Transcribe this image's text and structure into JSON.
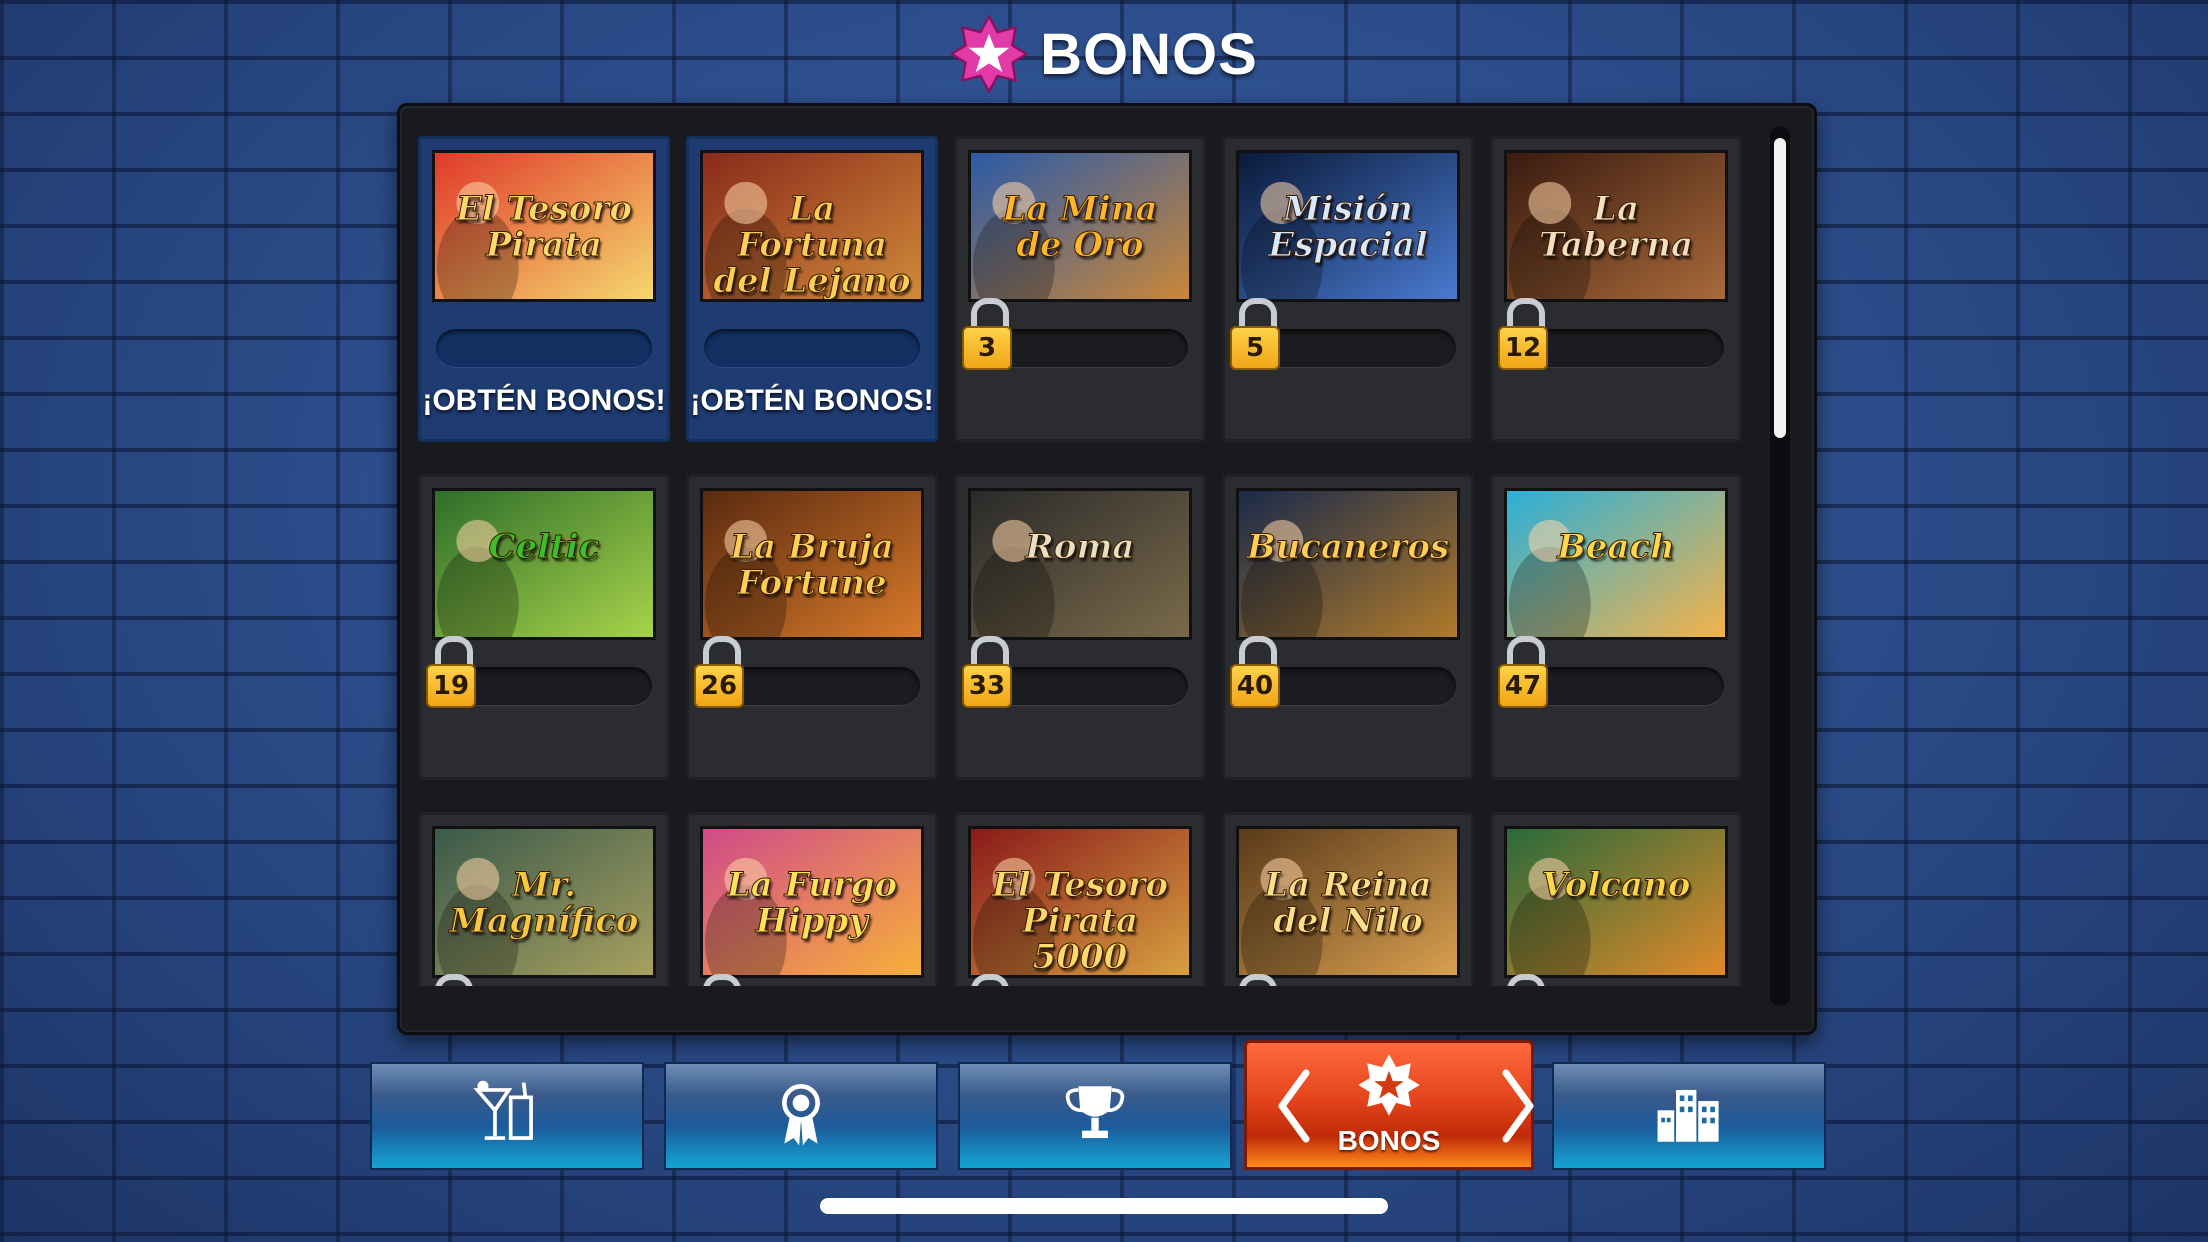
{
  "title": {
    "text": "BONOS",
    "icon": "star-badge-icon",
    "accent": "#e23aa6"
  },
  "cards": [
    {
      "name": "El Tesoro Pirata",
      "state": "unlocked",
      "action": "¡OBTÉN BONOS!",
      "colors": [
        "#e03a2a",
        "#f5d76e"
      ],
      "text_color": "#ffd86a"
    },
    {
      "name": "La Fortuna del Lejano Oeste",
      "state": "unlocked",
      "action": "¡OBTÉN BONOS!",
      "colors": [
        "#8a2a1a",
        "#d08a3a"
      ],
      "text_color": "#ffcf55"
    },
    {
      "name": "La Mina de Oro",
      "state": "locked",
      "level": "3",
      "colors": [
        "#2b5aa8",
        "#c9873a"
      ],
      "text_color": "#ffb62a"
    },
    {
      "name": "Misión Espacial",
      "state": "locked",
      "level": "5",
      "colors": [
        "#0a1a3a",
        "#4a7ad0"
      ],
      "text_color": "#d8e8ff"
    },
    {
      "name": "La Taberna",
      "state": "locked",
      "level": "12",
      "colors": [
        "#3a1a10",
        "#a86a3a"
      ],
      "text_color": "#f3e0c0"
    },
    {
      "name": "Celtic",
      "state": "locked",
      "level": "19",
      "colors": [
        "#2f6e2a",
        "#a7d34a"
      ],
      "text_color": "#3cbd2c"
    },
    {
      "name": "La Bruja Fortune",
      "state": "locked",
      "level": "26",
      "colors": [
        "#5a2a10",
        "#d87a2a"
      ],
      "text_color": "#ffcf55"
    },
    {
      "name": "Roma",
      "state": "locked",
      "level": "33",
      "colors": [
        "#2a2a2a",
        "#7a6a4a"
      ],
      "text_color": "#e8e0c0"
    },
    {
      "name": "Bucaneros",
      "state": "locked",
      "level": "40",
      "colors": [
        "#1a2a4a",
        "#b07a2a"
      ],
      "text_color": "#ffcf55"
    },
    {
      "name": "Beach",
      "state": "locked",
      "level": "47",
      "colors": [
        "#2ab0d8",
        "#f4b24a"
      ],
      "text_color": "#ffd84a"
    },
    {
      "name": "Mr. Magnífico",
      "state": "locked",
      "level": "",
      "colors": [
        "#3a5a4a",
        "#a8a060"
      ],
      "text_color": "#f6c940"
    },
    {
      "name": "La Furgo Hippy",
      "state": "locked",
      "level": "",
      "colors": [
        "#d04a8a",
        "#f7b03a"
      ],
      "text_color": "#ffe15a"
    },
    {
      "name": "El Tesoro Pirata 5000",
      "state": "locked",
      "level": "",
      "colors": [
        "#8a1a1a",
        "#d8a040"
      ],
      "text_color": "#ffd86a"
    },
    {
      "name": "La Reina del Nilo",
      "state": "locked",
      "level": "",
      "colors": [
        "#5a3a1a",
        "#d8a050"
      ],
      "text_color": "#ffe08a"
    },
    {
      "name": "Volcano",
      "state": "locked",
      "level": "",
      "colors": [
        "#2a6a3a",
        "#e08a2a"
      ],
      "text_color": "#ffd84a"
    }
  ],
  "nav": [
    {
      "id": "bar",
      "icon": "cocktail-icon",
      "label": "",
      "active": false
    },
    {
      "id": "awards",
      "icon": "award-ribbon-icon",
      "label": "",
      "active": false
    },
    {
      "id": "tournaments",
      "icon": "trophy-icon",
      "label": "",
      "active": false
    },
    {
      "id": "bonos",
      "icon": "star-badge-icon",
      "label": "BONOS",
      "active": true
    },
    {
      "id": "city",
      "icon": "buildings-icon",
      "label": "",
      "active": false
    }
  ]
}
